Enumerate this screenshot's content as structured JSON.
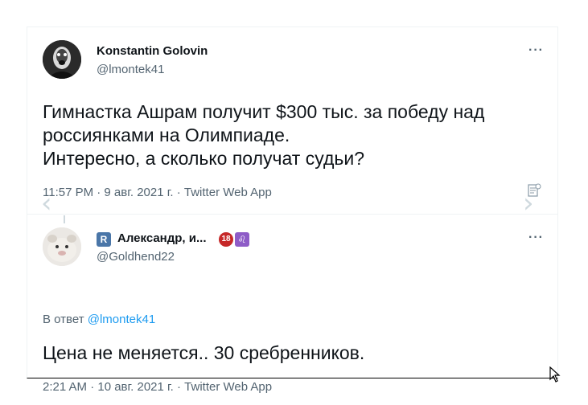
{
  "tweet": {
    "author_name": "Konstantin Golovin",
    "author_handle": "@lmontek41",
    "more_label": "···",
    "text_lines": [
      "Гимнастка Ашрам получит $300 тыс. за победу над",
      "россиянками на Олимпиаде.",
      "Интересно, а сколько получат судьи?"
    ],
    "meta": "11:57 PM · 9 авг. 2021 г. · Twitter Web App"
  },
  "reply": {
    "author_name": "Александр, и...",
    "author_handle": "@Goldhend22",
    "more_label": "···",
    "badges": [
      {
        "label": "R",
        "color": "#4a76a8"
      },
      {
        "label": "18",
        "color": "#c62828"
      },
      {
        "label": "♌",
        "color": "#8e5cc7"
      }
    ],
    "reply_prefix": "В ответ",
    "reply_to": "@lmontek41",
    "text": "Цена не меняется.. 30 сребренников.",
    "meta": "2:21 AM · 10 авг. 2021 г. · Twitter Web App"
  },
  "colors": {
    "accent": "#1d9bf0",
    "secondary_text": "#536471",
    "border": "#eff3f4"
  }
}
